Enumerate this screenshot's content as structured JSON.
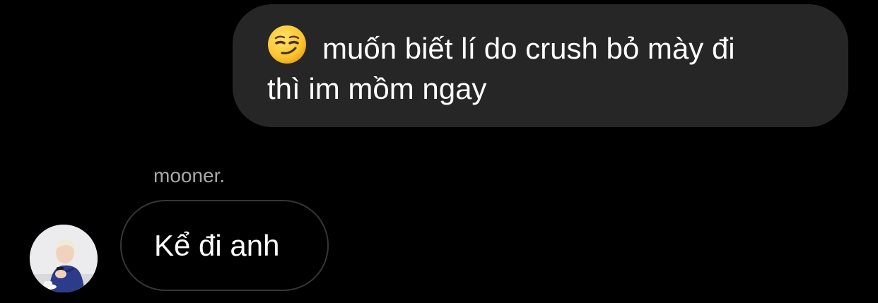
{
  "thread": {
    "outgoing_message": {
      "emoji": "smirking-face",
      "text_line1": "muốn biết lí do crush bỏ mày đi",
      "text_line2": "thì im mồm ngay"
    },
    "incoming_message": {
      "sender_name": "mooner.",
      "text": "Kể đi anh"
    }
  },
  "colors": {
    "background": "#000000",
    "outgoing_bubble": "#262626",
    "incoming_bubble_border": "#363636",
    "sender_name": "#a8a8a8",
    "text": "#ffffff"
  }
}
